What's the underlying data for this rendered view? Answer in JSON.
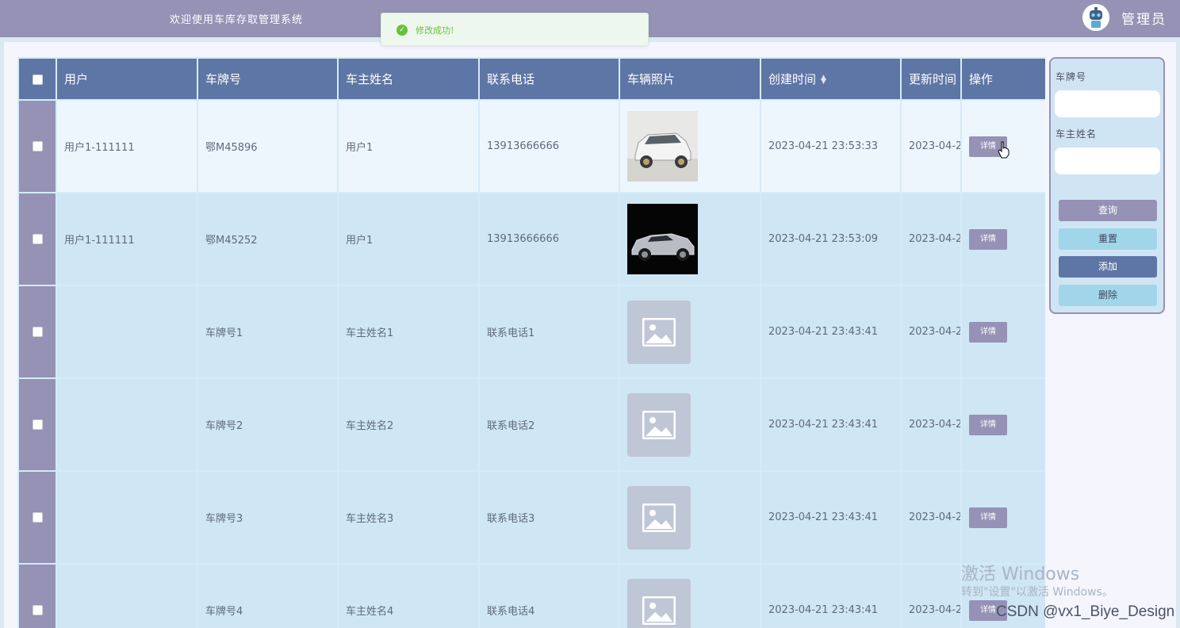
{
  "header": {
    "title": "欢迎使用车库存取管理系统",
    "role": "管理员"
  },
  "toast": {
    "message": "修改成功!"
  },
  "table": {
    "columns": [
      "用户",
      "车牌号",
      "车主姓名",
      "联系电话",
      "车辆照片",
      "创建时间",
      "更新时间",
      "操作"
    ],
    "rows": [
      {
        "user": "用户1-111111",
        "plate": "鄂M45896",
        "owner": "用户1",
        "phone": "13913666666",
        "photo": "white-suv",
        "created": "2023-04-21 23:53:33",
        "updated": "2023-04-2",
        "action": "详情"
      },
      {
        "user": "用户1-111111",
        "plate": "鄂M45252",
        "owner": "用户1",
        "phone": "13913666666",
        "photo": "silver-convertible",
        "created": "2023-04-21 23:53:09",
        "updated": "2023-04-2",
        "action": "详情"
      },
      {
        "user": "",
        "plate": "车牌号1",
        "owner": "车主姓名1",
        "phone": "联系电话1",
        "photo": "placeholder",
        "created": "2023-04-21 23:43:41",
        "updated": "2023-04-2",
        "action": "详情"
      },
      {
        "user": "",
        "plate": "车牌号2",
        "owner": "车主姓名2",
        "phone": "联系电话2",
        "photo": "placeholder",
        "created": "2023-04-21 23:43:41",
        "updated": "2023-04-2",
        "action": "详情"
      },
      {
        "user": "",
        "plate": "车牌号3",
        "owner": "车主姓名3",
        "phone": "联系电话3",
        "photo": "placeholder",
        "created": "2023-04-21 23:43:41",
        "updated": "2023-04-2",
        "action": "详情"
      },
      {
        "user": "",
        "plate": "车牌号4",
        "owner": "车主姓名4",
        "phone": "联系电话4",
        "photo": "placeholder",
        "created": "2023-04-21 23:43:41",
        "updated": "2023-04-2",
        "action": "详情"
      }
    ]
  },
  "search": {
    "plate_label": "车牌号",
    "plate_value": "",
    "owner_label": "车主姓名",
    "owner_value": "",
    "query_label": "查询",
    "reset_label": "重置",
    "add_label": "添加",
    "delete_label": "删除"
  },
  "colors": {
    "header_bg": "#9592b5",
    "table_header": "#5e76a5",
    "row_bg": "#cfe6f4",
    "success": "#67c23a",
    "button_query": "#9592b5",
    "button_reset": "#a1d6ea",
    "button_add": "#5e76a5",
    "button_delete": "#a1d6ea"
  },
  "overlay": {
    "activate_title": "激活 Windows",
    "activate_sub": "转到\"设置\"以激活 Windows。",
    "credit": "CSDN @vx1_Biye_Design"
  }
}
